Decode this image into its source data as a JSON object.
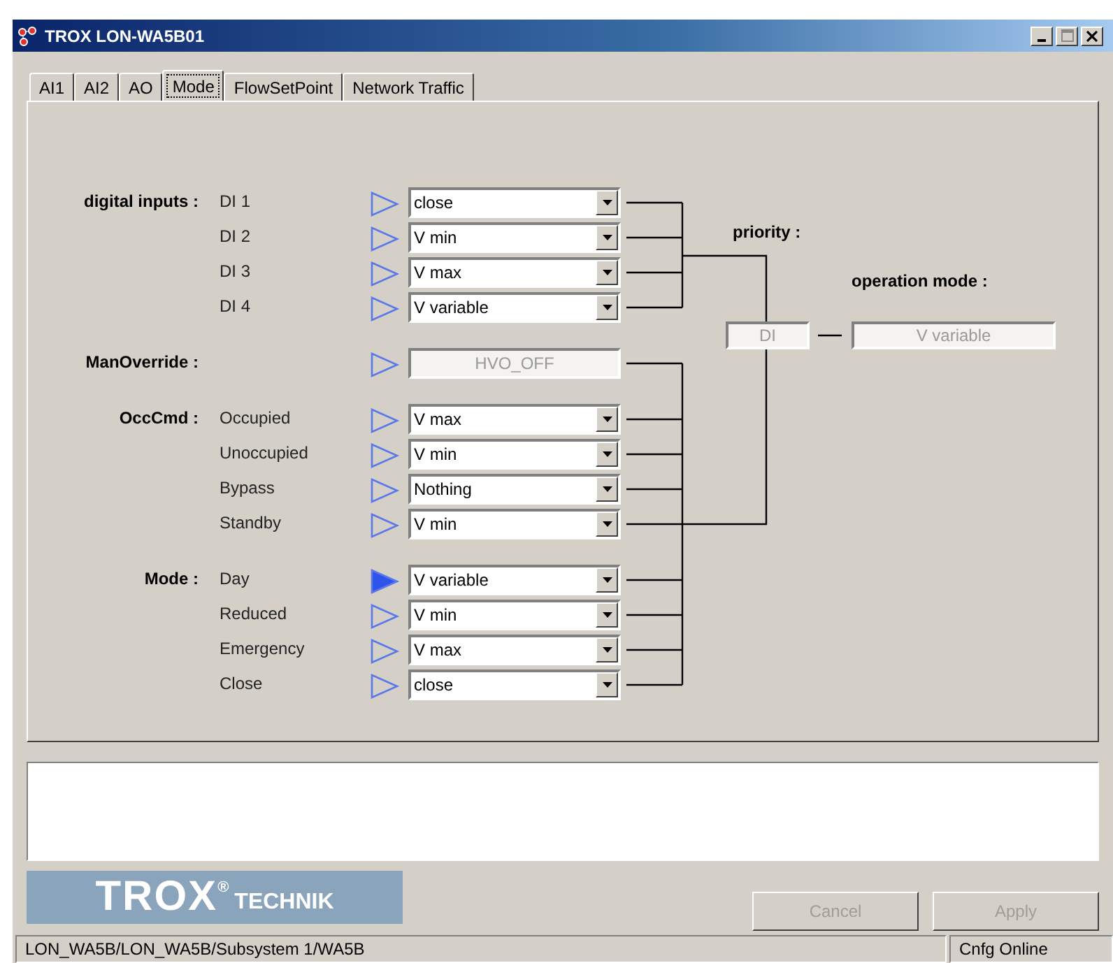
{
  "window": {
    "title": "TROX LON-WA5B01"
  },
  "tabs": [
    {
      "label": "AI1",
      "selected": false
    },
    {
      "label": "AI2",
      "selected": false
    },
    {
      "label": "AO",
      "selected": false
    },
    {
      "label": "Mode",
      "selected": true
    },
    {
      "label": "FlowSetPoint",
      "selected": false
    },
    {
      "label": "Network Traffic",
      "selected": false
    }
  ],
  "groups": [
    {
      "label": "digital inputs :",
      "inputs": [
        {
          "label": "DI 1",
          "active": false,
          "value": "close",
          "disabled": false
        },
        {
          "label": "DI 2",
          "active": false,
          "value": "V min",
          "disabled": false
        },
        {
          "label": "DI 3",
          "active": false,
          "value": "V max",
          "disabled": false
        },
        {
          "label": "DI 4",
          "active": false,
          "value": "V variable",
          "disabled": false
        }
      ]
    },
    {
      "label": "ManOverride :",
      "inputs": [
        {
          "active": false,
          "value": "HVO_OFF",
          "disabled": true
        }
      ]
    },
    {
      "label": "OccCmd :",
      "inputs": [
        {
          "label": "Occupied",
          "active": false,
          "value": "V max",
          "disabled": false
        },
        {
          "label": "Unoccupied",
          "active": false,
          "value": "V min",
          "disabled": false
        },
        {
          "label": "Bypass",
          "active": false,
          "value": "Nothing",
          "disabled": false
        },
        {
          "label": "Standby",
          "active": false,
          "value": "V min",
          "disabled": false
        }
      ]
    },
    {
      "label": "Mode :",
      "inputs": [
        {
          "label": "Day",
          "active": true,
          "value": "V variable",
          "disabled": false
        },
        {
          "label": "Reduced",
          "active": false,
          "value": "V min",
          "disabled": false
        },
        {
          "label": "Emergency",
          "active": false,
          "value": "V max",
          "disabled": false
        },
        {
          "label": "Close",
          "active": false,
          "value": "close",
          "disabled": false
        }
      ]
    }
  ],
  "priority": {
    "label": "priority :",
    "value": "DI"
  },
  "operation_mode": {
    "label": "operation mode :",
    "value": "V variable"
  },
  "logo": {
    "brand": "TROX",
    "registered": "®",
    "suffix": "TECHNIK"
  },
  "buttons": [
    {
      "label": "Cancel",
      "disabled": true
    },
    {
      "label": "Apply",
      "disabled": true
    }
  ],
  "status_bar": {
    "path": "LON_WA5B/LON_WA5B/Subsystem 1/WA5B",
    "state": "Cnfg Online"
  }
}
